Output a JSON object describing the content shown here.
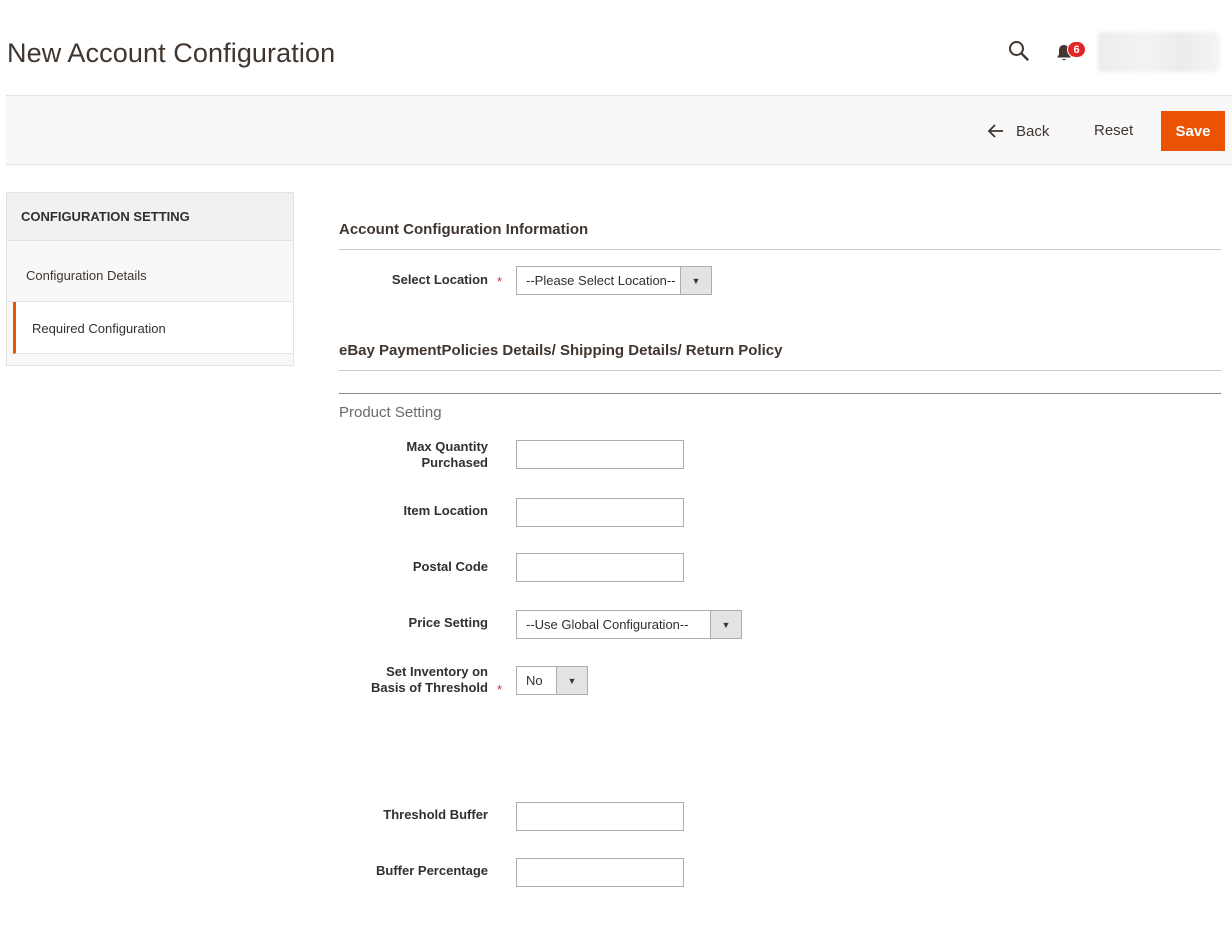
{
  "header": {
    "title": "New Account Configuration",
    "notification_count": "6"
  },
  "toolbar": {
    "back_label": "Back",
    "reset_label": "Reset",
    "save_label": "Save"
  },
  "sidebar": {
    "title": "CONFIGURATION SETTING",
    "items": [
      {
        "label": "Configuration Details"
      },
      {
        "label": "Required Configuration"
      }
    ]
  },
  "main": {
    "section1_title": "Account Configuration Information",
    "select_location": {
      "label": "Select Location",
      "value": "--Please Select Location--"
    },
    "section2_title": "eBay PaymentPolicies Details/ Shipping Details/ Return Policy",
    "product_setting_title": "Product Setting",
    "fields": {
      "max_quantity_line1": "Max Quantity",
      "max_quantity_line2": "Purchased",
      "item_location": "Item Location",
      "postal_code": "Postal Code",
      "price_setting": {
        "label": "Price Setting",
        "value": "--Use Global Configuration--"
      },
      "set_inventory_line1": "Set Inventory on",
      "set_inventory_line2": "Basis of Threshold",
      "set_inventory_value": "No",
      "threshold_buffer": "Threshold Buffer",
      "buffer_percentage": "Buffer Percentage"
    },
    "required_mark": "*"
  },
  "colors": {
    "accent": "#eb5202",
    "badge": "#e22626",
    "text": "#303030"
  }
}
